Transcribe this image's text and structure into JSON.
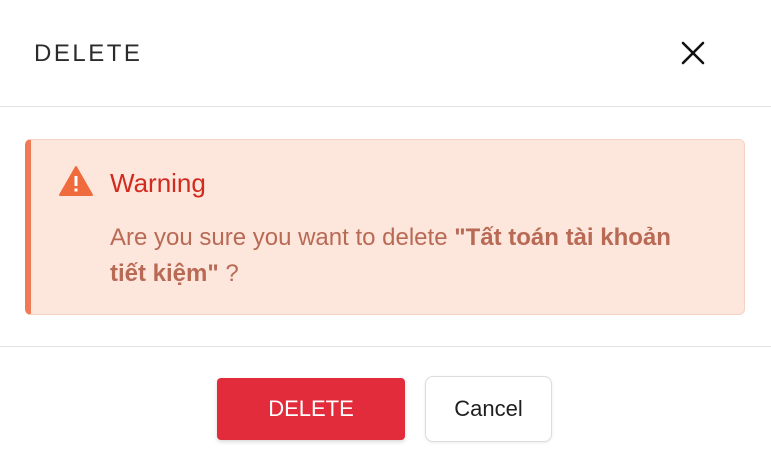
{
  "dialog": {
    "title": "DELETE",
    "close_icon": "close-icon"
  },
  "alert": {
    "icon": "warning-triangle-icon",
    "title": "Warning",
    "message_prefix": "Are you sure you want to delete ",
    "item_name": "\"Tất toán tài khoản tiết kiệm\"",
    "message_suffix": " ?",
    "colors": {
      "background": "#fde6dc",
      "accent": "#ee7a57",
      "title": "#d22a1e",
      "text": "#b86a55"
    }
  },
  "footer": {
    "delete_label": "DELETE",
    "cancel_label": "Cancel",
    "delete_color": "#e22c3c"
  }
}
